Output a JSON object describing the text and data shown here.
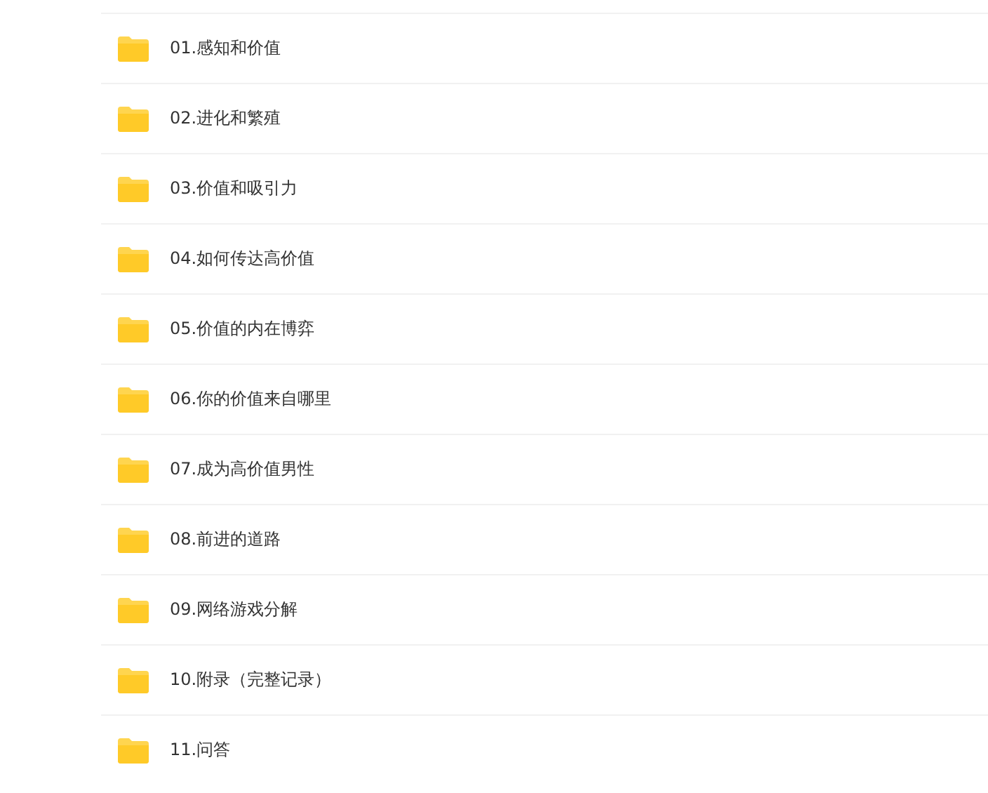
{
  "folders": [
    {
      "name": "01.感知和价值"
    },
    {
      "name": "02.进化和繁殖"
    },
    {
      "name": "03.价值和吸引力"
    },
    {
      "name": "04.如何传达高价值"
    },
    {
      "name": "05.价值的内在博弈"
    },
    {
      "name": "06.你的价值来自哪里"
    },
    {
      "name": "07.成为高价值男性"
    },
    {
      "name": "08.前进的道路"
    },
    {
      "name": "09.网络游戏分解"
    },
    {
      "name": "10.附录（完整记录）"
    },
    {
      "name": "11.问答"
    }
  ]
}
